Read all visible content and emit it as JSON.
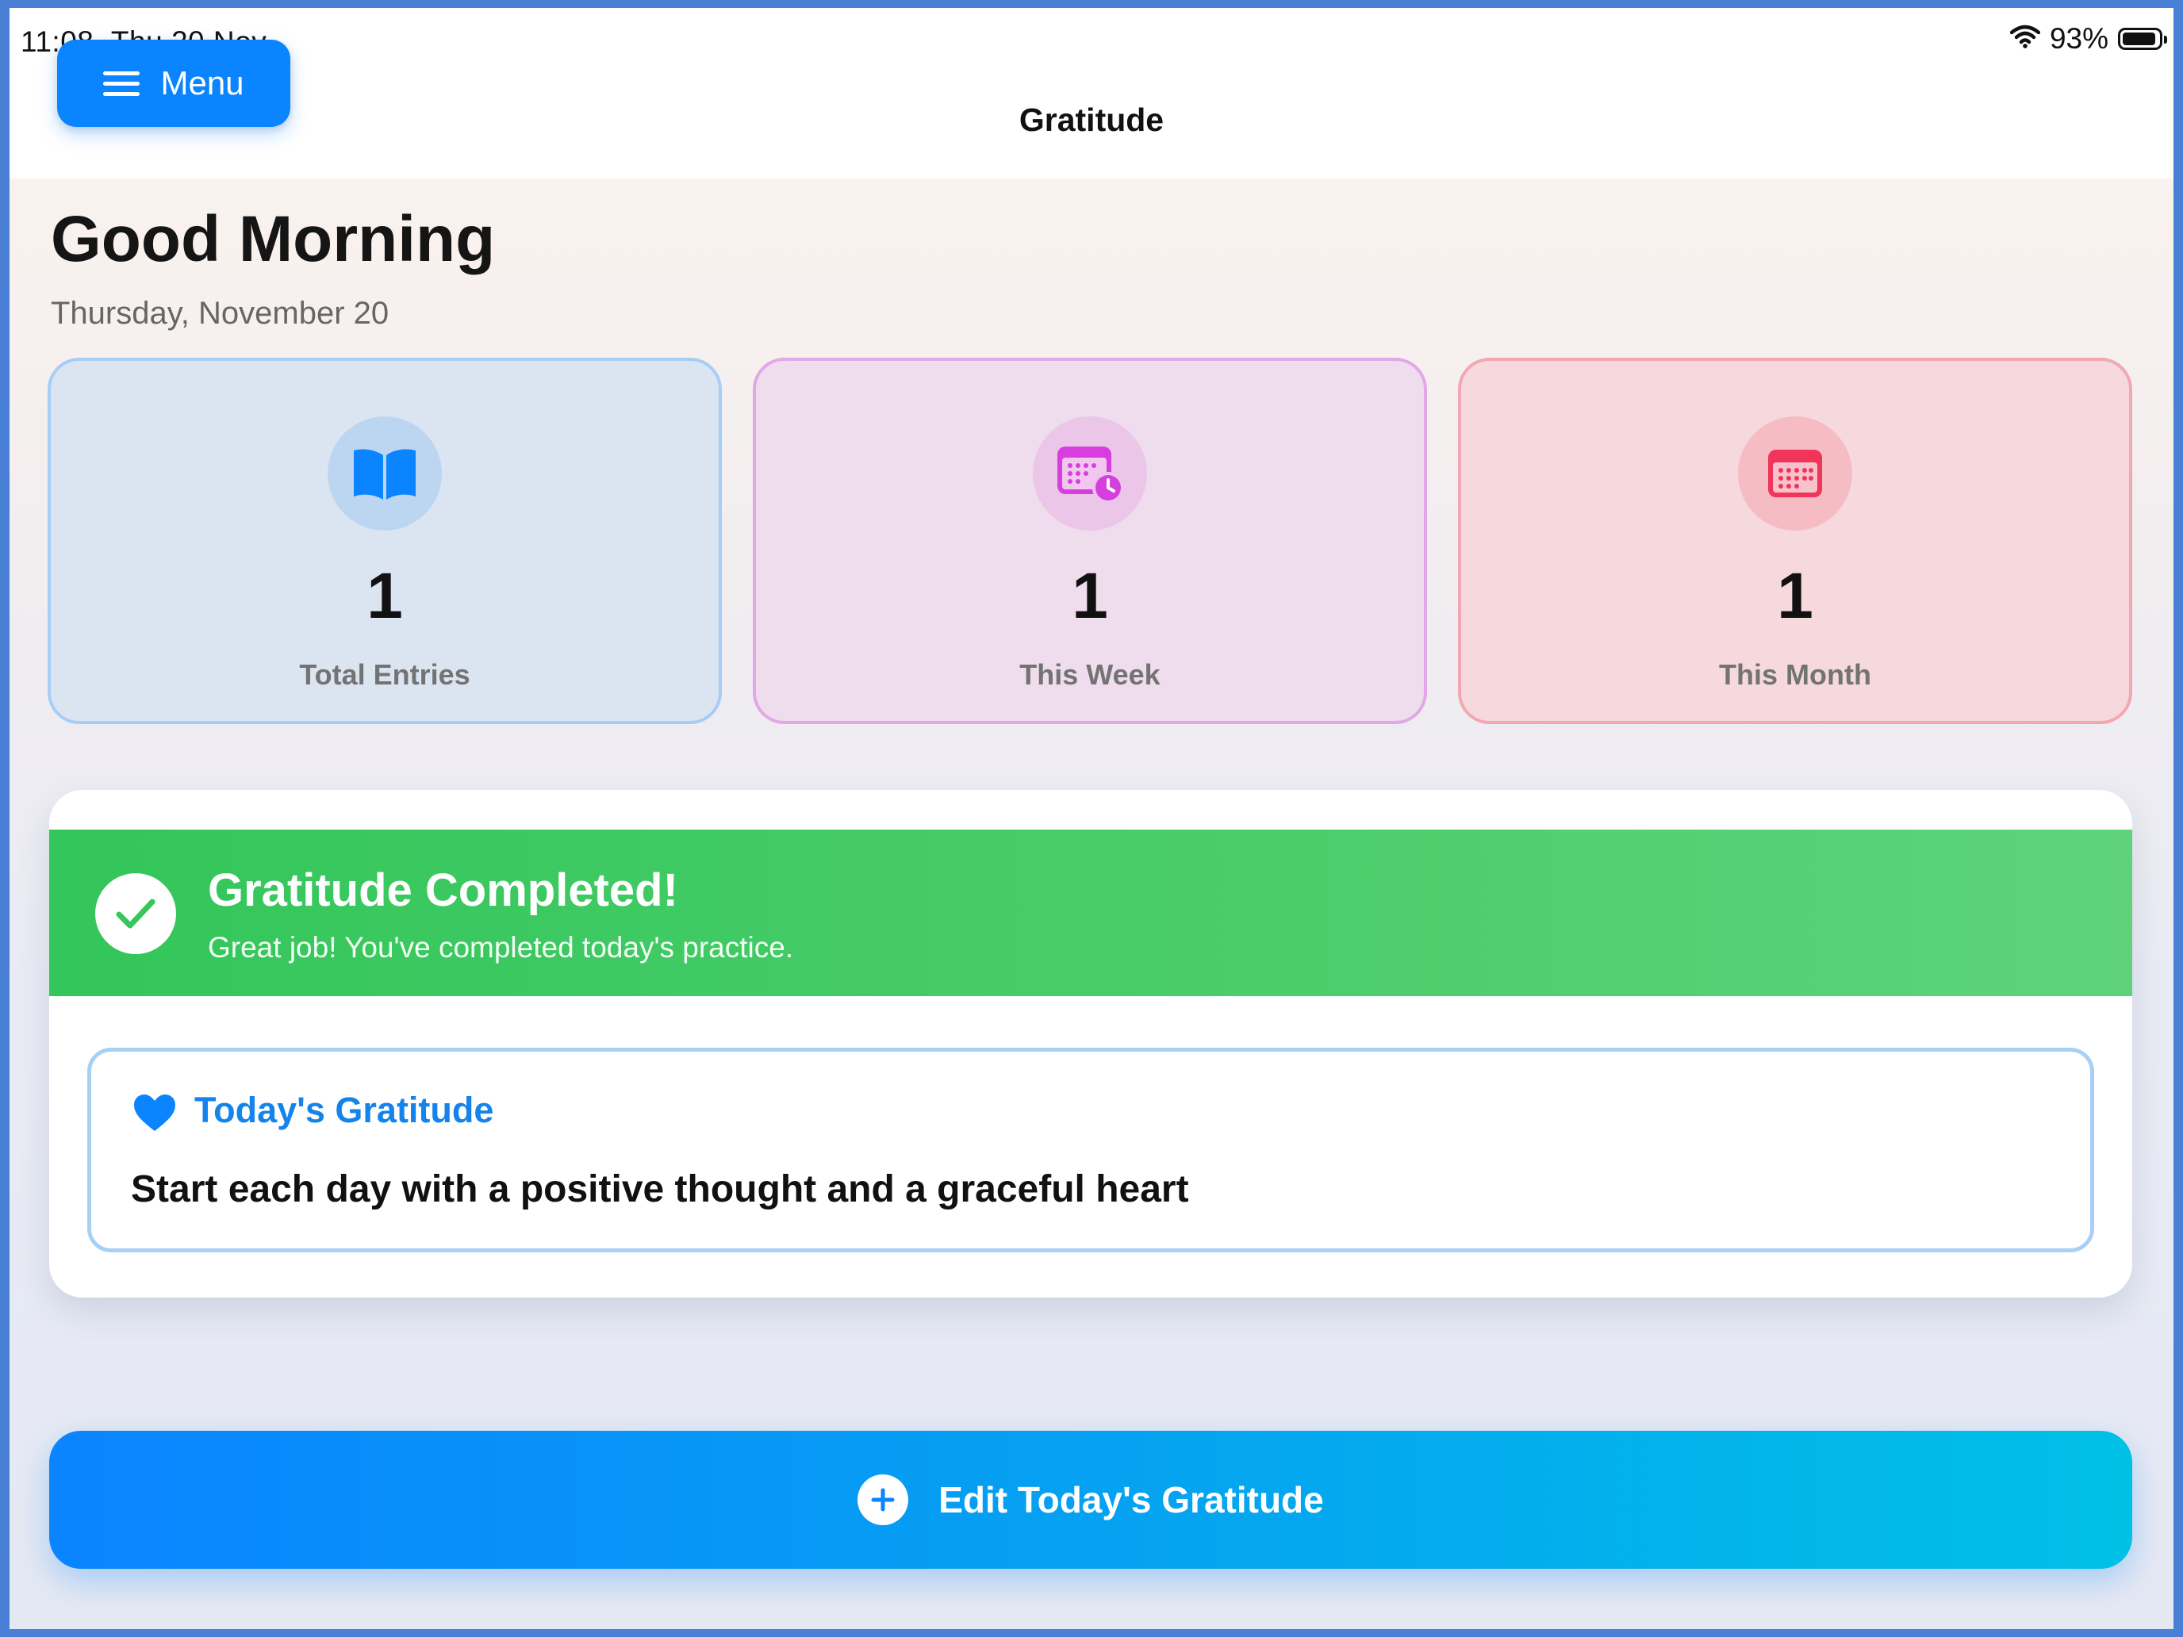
{
  "status_bar": {
    "time": "11:08",
    "date": "Thu 20 Nov",
    "battery": "93%",
    "battery_level": 0.93,
    "icons": [
      "wifi-icon",
      "battery-icon"
    ]
  },
  "nav": {
    "menu_label": "Menu",
    "title": "Gratitude"
  },
  "header": {
    "greeting": "Good Morning",
    "date": "Thursday, November 20"
  },
  "stats": [
    {
      "value": "1",
      "label": "Total Entries",
      "icon": "book-open-icon",
      "color": "#0a84ff"
    },
    {
      "value": "1",
      "label": "This Week",
      "icon": "calendar-clock-icon",
      "color": "#d63ee0"
    },
    {
      "value": "1",
      "label": "This Month",
      "icon": "calendar-icon",
      "color": "#f0345a"
    }
  ],
  "completion": {
    "title": "Gratitude Completed!",
    "subtitle": "Great job! You've completed today's practice.",
    "icon": "checkmark-icon",
    "color": "#34c759"
  },
  "todays_gratitude": {
    "title": "Today's Gratitude",
    "text": "Start each day with a positive thought and a graceful heart",
    "icon": "heart-icon"
  },
  "edit_button": {
    "label": "Edit Today's Gratitude",
    "icon": "plus-circle-icon"
  },
  "colors": {
    "accent": "#0a84ff",
    "success": "#34c759"
  }
}
